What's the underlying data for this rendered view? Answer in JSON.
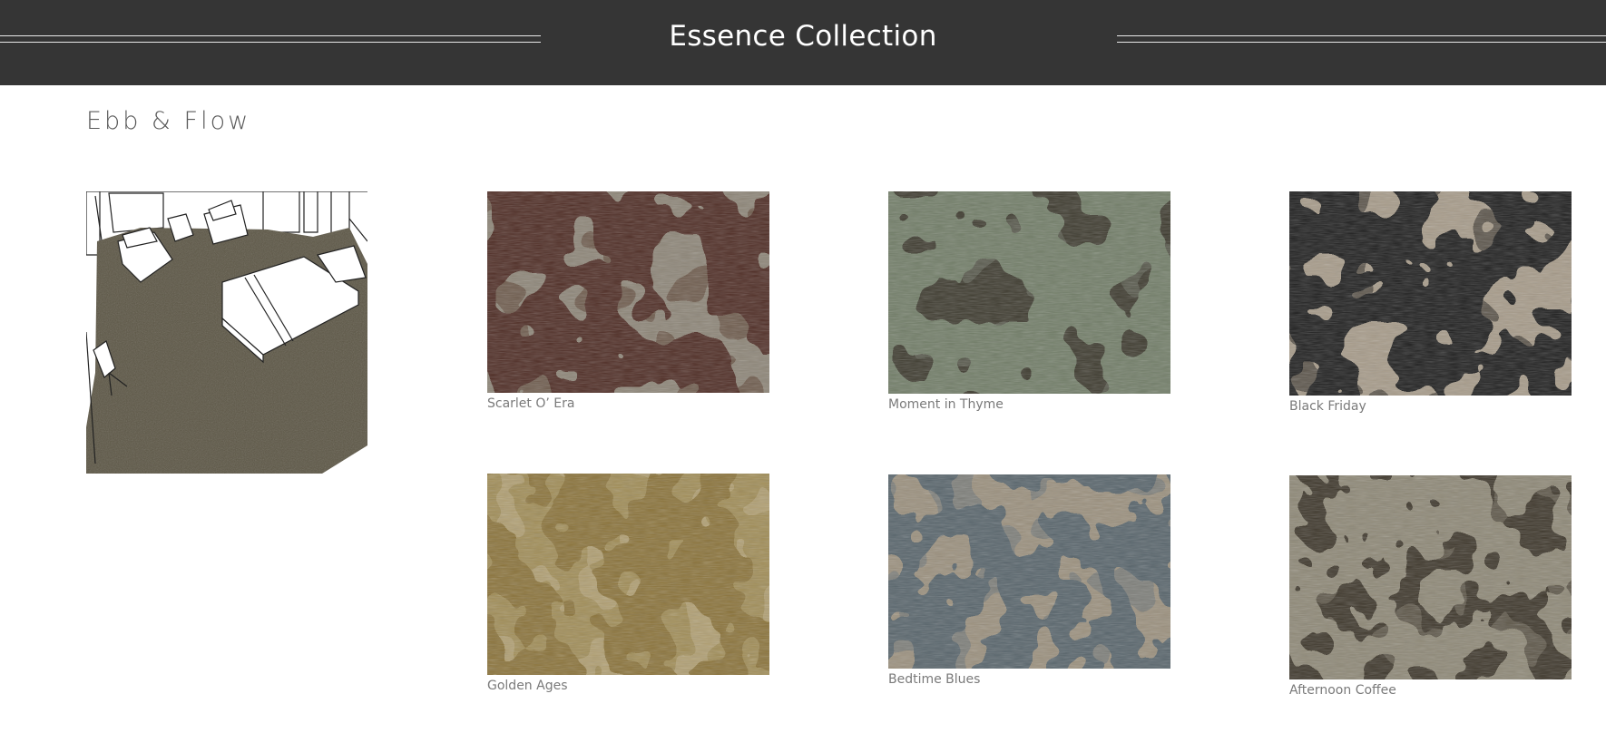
{
  "header": {
    "title": "Essence Collection"
  },
  "section": {
    "title": "Ebb & Flow"
  },
  "colors": {
    "header_bg": "#353535",
    "page_bg": "#ffffff",
    "label_text": "#7a7a7a"
  },
  "swatches": [
    {
      "name": "Scarlet O’ Era",
      "base": "#8c8476",
      "pattern": "#4e2c23",
      "alt": "#6d5a4c"
    },
    {
      "name": "Moment in Thyme",
      "base": "#3b382c",
      "pattern": "#6f7b66",
      "alt": "#55574a"
    },
    {
      "name": "Black Friday",
      "base": "#a69a88",
      "pattern": "#1c1c1c",
      "alt": "#5a5348"
    },
    {
      "name": "Golden Ages",
      "base": "#a08c55",
      "pattern": "#8a7238",
      "alt": "#b09e70"
    },
    {
      "name": "Bedtime Blues",
      "base": "#9a8f7c",
      "pattern": "#56636a",
      "alt": "#7b7d78"
    },
    {
      "name": "Afternoon Coffee",
      "base": "#3b3428",
      "pattern": "#8d8775",
      "alt": "#5c5446"
    }
  ]
}
